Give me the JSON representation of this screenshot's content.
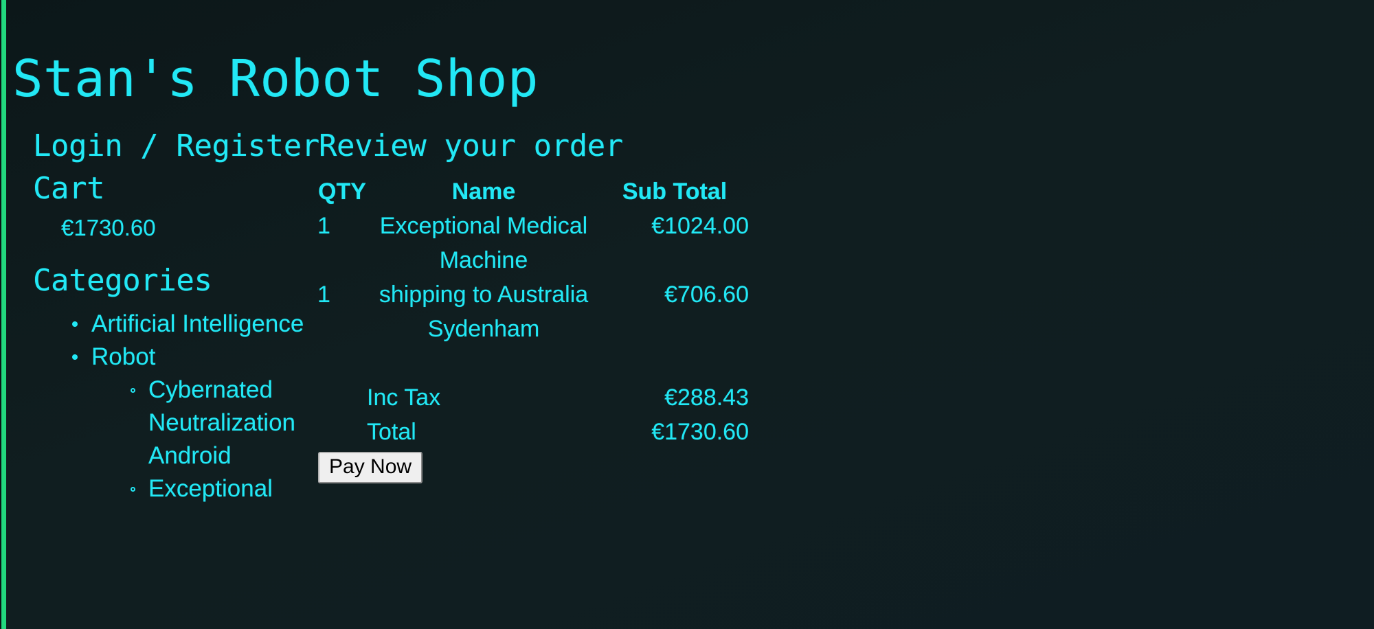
{
  "site": {
    "title": "Stan's Robot Shop",
    "accent_color": "#22e8f5",
    "edge_color": "#22d87e",
    "background_color": "#101e20"
  },
  "sidebar": {
    "login_register": "Login / Register",
    "cart_heading": "Cart",
    "cart_total": "€1730.60",
    "categories_heading": "Categories",
    "categories": [
      {
        "label": "Artificial Intelligence",
        "children": []
      },
      {
        "label": "Robot",
        "children": [
          {
            "label": "Cybernated Neutralization Android"
          },
          {
            "label": "Exceptional"
          }
        ]
      }
    ]
  },
  "order": {
    "heading": "Review your order",
    "columns": [
      "QTY",
      "Name",
      "Sub Total"
    ],
    "rows": [
      {
        "qty": "1",
        "name": "Exceptional Medical Machine",
        "sub_total": "€1024.00"
      },
      {
        "qty": "1",
        "name": "shipping to Australia Sydenham",
        "sub_total": "€706.60"
      }
    ],
    "summary": [
      {
        "label": "Inc Tax",
        "value": "€288.43"
      },
      {
        "label": "Total",
        "value": "€1730.60"
      }
    ],
    "pay_button": "Pay Now"
  }
}
